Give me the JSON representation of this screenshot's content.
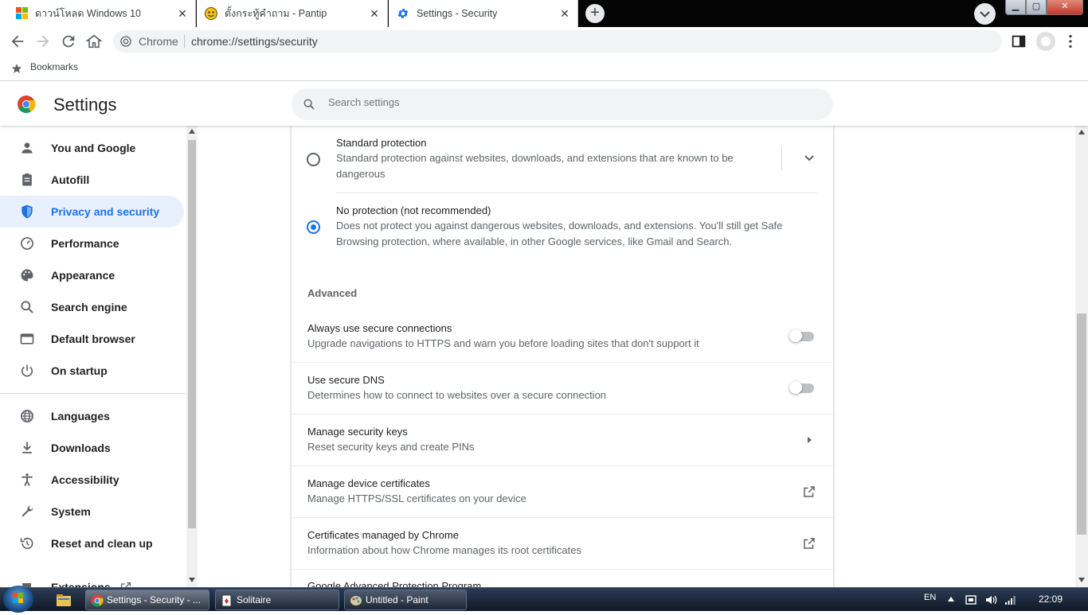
{
  "tabs": [
    {
      "title": "ดาวน์โหลด Windows 10",
      "close": "✕"
    },
    {
      "title": "ตั้งกระทู้คำถาม - Pantip",
      "close": "✕"
    },
    {
      "title": "Settings - Security",
      "close": "✕"
    }
  ],
  "new_tab": "+",
  "window_controls": {
    "minimize": "▁",
    "maximize": "▢",
    "close": "✕"
  },
  "omnibox": {
    "chip": "Chrome",
    "url": "chrome://settings/security"
  },
  "bookmarks": {
    "label": "Bookmarks"
  },
  "settings": {
    "title": "Settings",
    "search_placeholder": "Search settings"
  },
  "sidebar": {
    "items": [
      {
        "label": "You and Google",
        "icon": "person-icon"
      },
      {
        "label": "Autofill",
        "icon": "clipboard-icon"
      },
      {
        "label": "Privacy and security",
        "icon": "shield-icon",
        "selected": true
      },
      {
        "label": "Performance",
        "icon": "speedometer-icon"
      },
      {
        "label": "Appearance",
        "icon": "palette-icon"
      },
      {
        "label": "Search engine",
        "icon": "search-icon"
      },
      {
        "label": "Default browser",
        "icon": "browser-window-icon"
      },
      {
        "label": "On startup",
        "icon": "power-icon"
      },
      {
        "label": "Languages",
        "icon": "globe-icon"
      },
      {
        "label": "Downloads",
        "icon": "download-icon"
      },
      {
        "label": "Accessibility",
        "icon": "accessibility-icon"
      },
      {
        "label": "System",
        "icon": "wrench-icon"
      },
      {
        "label": "Reset and clean up",
        "icon": "reset-icon"
      },
      {
        "label": "Extensions",
        "icon": "external-link-icon"
      }
    ]
  },
  "protection": {
    "standard": {
      "title": "Standard protection",
      "description": "Standard protection against websites, downloads, and extensions that are known to be dangerous",
      "checked": false
    },
    "none": {
      "title": "No protection (not recommended)",
      "description": "Does not protect you against dangerous websites, downloads, and extensions. You'll still get Safe Browsing protection, where available, in other Google services, like Gmail and Search.",
      "checked": true
    }
  },
  "advanced": {
    "heading": "Advanced",
    "rows": [
      {
        "title": "Always use secure connections",
        "subtitle": "Upgrade navigations to HTTPS and warn you before loading sites that don't support it",
        "control": "toggle",
        "on": false
      },
      {
        "title": "Use secure DNS",
        "subtitle": "Determines how to connect to websites over a secure connection",
        "control": "toggle",
        "on": false
      },
      {
        "title": "Manage security keys",
        "subtitle": "Reset security keys and create PINs",
        "control": "arrow-right-icon"
      },
      {
        "title": "Manage device certificates",
        "subtitle": "Manage HTTPS/SSL certificates on your device",
        "control": "external-link-icon"
      },
      {
        "title": "Certificates managed by Chrome",
        "subtitle": "Information about how Chrome manages its root certificates",
        "control": "external-link-icon"
      },
      {
        "title": "Google Advanced Protection Program",
        "subtitle": "",
        "control": ""
      }
    ]
  },
  "taskbar": {
    "buttons": [
      {
        "label": "Settings - Security - ..."
      },
      {
        "label": "Solitaire"
      },
      {
        "label": "Untitled - Paint"
      }
    ],
    "language": "EN",
    "clock": "22:09"
  }
}
